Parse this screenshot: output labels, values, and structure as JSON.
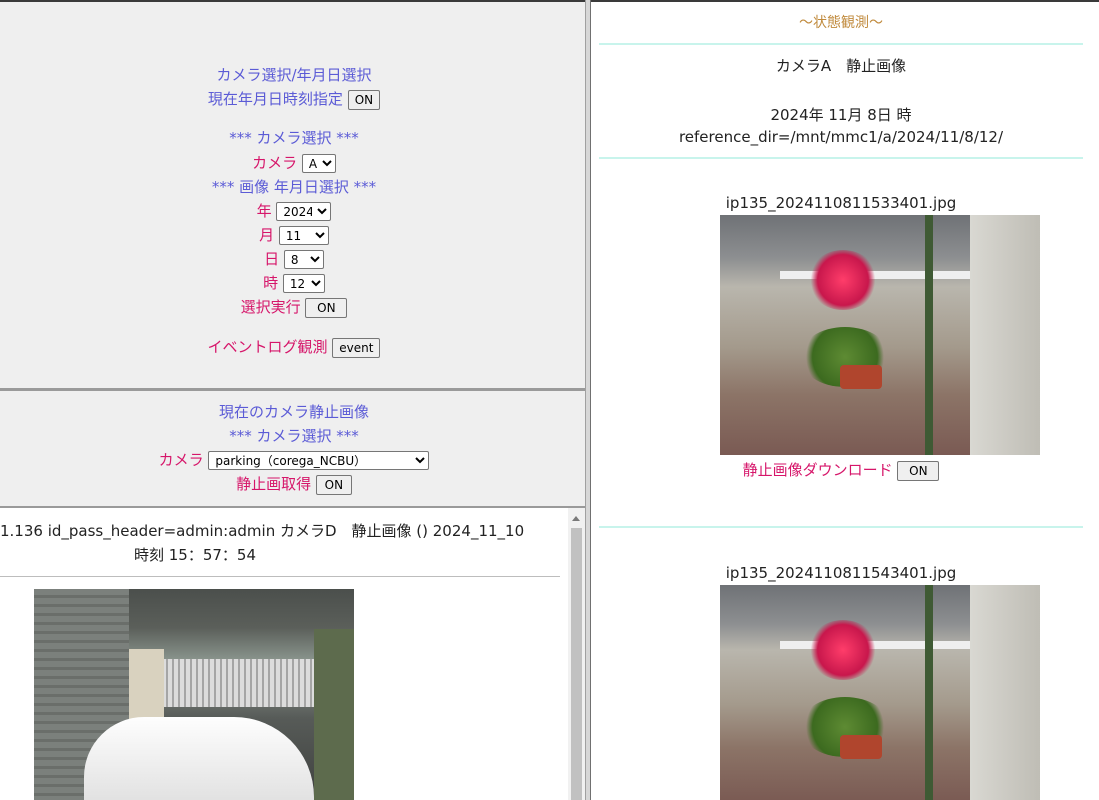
{
  "left_top": {
    "heading": "カメラ選択/年月日選択",
    "now_label": "現在年月日時刻指定",
    "now_button": "ON",
    "camera_section": "*** カメラ選択 ***",
    "camera_label": "カメラ",
    "camera_value": "A",
    "date_section": "*** 画像 年月日選択 ***",
    "year_label": "年",
    "year_value": "2024",
    "month_label": "月",
    "month_value": "11",
    "day_label": "日",
    "day_value": "8",
    "hour_label": "時",
    "hour_value": "12",
    "exec_label": "選択実行",
    "exec_button": "ON",
    "event_label": "イベントログ観測",
    "event_button": "event"
  },
  "left_mid": {
    "heading": "現在のカメラ静止画像",
    "camera_section": "*** カメラ選択 ***",
    "camera_label": "カメラ",
    "camera_value": "parking（corega_NCBU）",
    "get_label": "静止画取得",
    "get_button": "ON"
  },
  "left_bot": {
    "header_line1": "1.136 id_pass_header=admin:admin カメラD　静止画像 () 2024_11_10",
    "header_line2": "時刻 15：57：54"
  },
  "right": {
    "title": "～状態観測～",
    "camera_title": "カメラA　静止画像",
    "date_line": "2024年 11月 8日 時",
    "ref_dir": "reference_dir=/mnt/mmc1/a/2024/11/8/12/",
    "images": [
      {
        "filename": "ip135_2024110811533401.jpg",
        "download_label": "静止画像ダウンロード",
        "download_button": "ON"
      },
      {
        "filename": "ip135_2024110811543401.jpg"
      }
    ]
  },
  "colors": {
    "label_blue": "#5b5bd6",
    "label_pink": "#d6166a",
    "title_gold": "#c08a3c",
    "divider_cyan": "#c8f4ec",
    "panel_gray": "#efefef"
  }
}
